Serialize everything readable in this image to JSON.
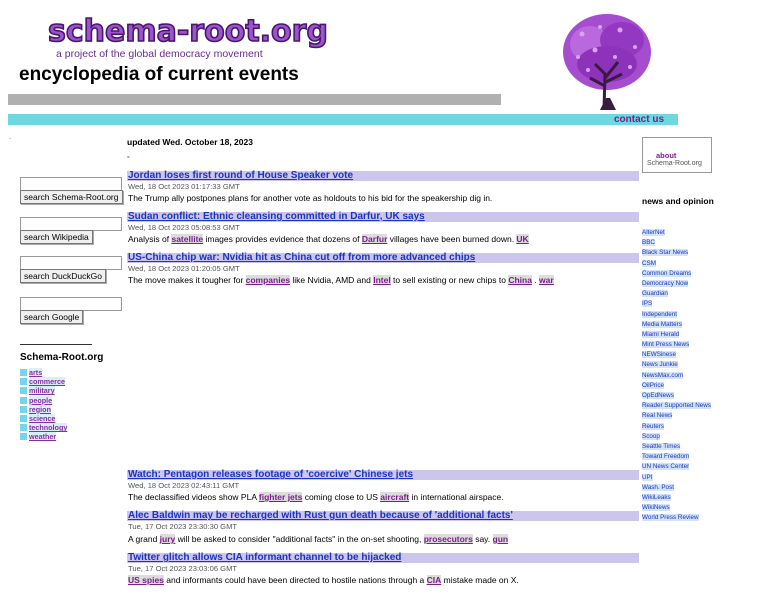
{
  "header": {
    "logo": "schema-root.org",
    "tagline": "a project of the global democracy movement",
    "title": "encyclopedia of current events",
    "contact": "contact us",
    "dot": "."
  },
  "left": {
    "search_buttons": [
      "search Schema-Root.org",
      "search Wikipedia",
      "search DuckDuckGo",
      "search Google"
    ],
    "section_title": "Schema-Root.org",
    "categories": [
      "arts",
      "commerce",
      "military",
      "people",
      "region",
      "science",
      "technology",
      "weather"
    ]
  },
  "main": {
    "updated": "updated Wed. October 18, 2023",
    "marker": "-",
    "articles": [
      {
        "title": "Jordan loses first round of House Speaker vote",
        "date": "Wed, 18 Oct 2023 01:17:33 GMT",
        "summary": "The Trump ally postpones plans for another vote as holdouts to his bid for the speakership dig in."
      },
      {
        "title": "Sudan conflict: Ethnic cleansing committed in Darfur, UK says",
        "date": "Wed, 18 Oct 2023 05:08:53 GMT",
        "summary_parts": [
          "Analysis of ",
          "satellite",
          " images provides evidence that dozens of ",
          "Darfur",
          " villages have been burned down. ",
          "UK"
        ]
      },
      {
        "title": "US-China chip war: Nvidia hit as China cut off from more advanced chips",
        "date": "Wed, 18 Oct 2023 01:20:05 GMT",
        "summary_parts": [
          "The move makes it tougher for ",
          "companies",
          " like Nvidia, AMD and ",
          "Intel",
          " to sell existing or new chips to ",
          "China",
          " . ",
          "war"
        ]
      },
      {
        "title": "Watch: Pentagon releases footage of 'coercive' Chinese jets",
        "date": "Wed, 18 Oct 2023 02:43:11 GMT",
        "summary_parts": [
          "The declassified videos show PLA ",
          "fighter jets",
          " coming close to US ",
          "aircraft",
          " in international airspace."
        ]
      },
      {
        "title": "Alec Baldwin may be recharged with Rust gun death because of 'additional facts'",
        "date": "Tue, 17 Oct 2023 23:30:30 GMT",
        "summary_parts": [
          "A grand ",
          "jury",
          " will be asked to consider \"additional facts\" in the on-set shooting, ",
          "prosecutors",
          " say. ",
          "gun"
        ]
      },
      {
        "title": "Twitter glitch allows CIA informant channel to be hijacked",
        "date": "Tue, 17 Oct 2023 23:03:06 GMT",
        "summary_parts": [
          "",
          "US spies",
          " and informants could have been directed to hostile nations through a ",
          "CIA",
          " mistake made on X."
        ]
      }
    ]
  },
  "right": {
    "about_link": "about",
    "about_site": "Schema-Root.org",
    "news_title": "news and opinion",
    "sources": [
      "AlterNet",
      "BBC",
      "Black Star News",
      "CSM",
      "Common Dreams",
      "Democracy Now",
      "Guardian",
      "IPS",
      "Independent",
      "Media Matters",
      "Miami Herald",
      "Mint Press News",
      "NEWSinese",
      "News Junkie",
      "NewsMax.com",
      "OilPrice",
      "OpEdNews",
      "Reader Supported News",
      "Real News",
      "Reuters",
      "Scoop",
      "Seattle Times",
      "Toward Freedom",
      "UN News Center",
      "UPI",
      "Wash. Post",
      "WikiLeaks",
      "WikiNews",
      "World Press Review"
    ]
  },
  "colors": {
    "accent": "#7a1f8a",
    "headline_bg": "#ccc5ec",
    "cyan_bar": "#6ed8e0",
    "gray_bar": "#b0b0b0",
    "link_blue": "#1a35c0"
  },
  "icons": {
    "logo_image": "purple-tree-icon"
  }
}
